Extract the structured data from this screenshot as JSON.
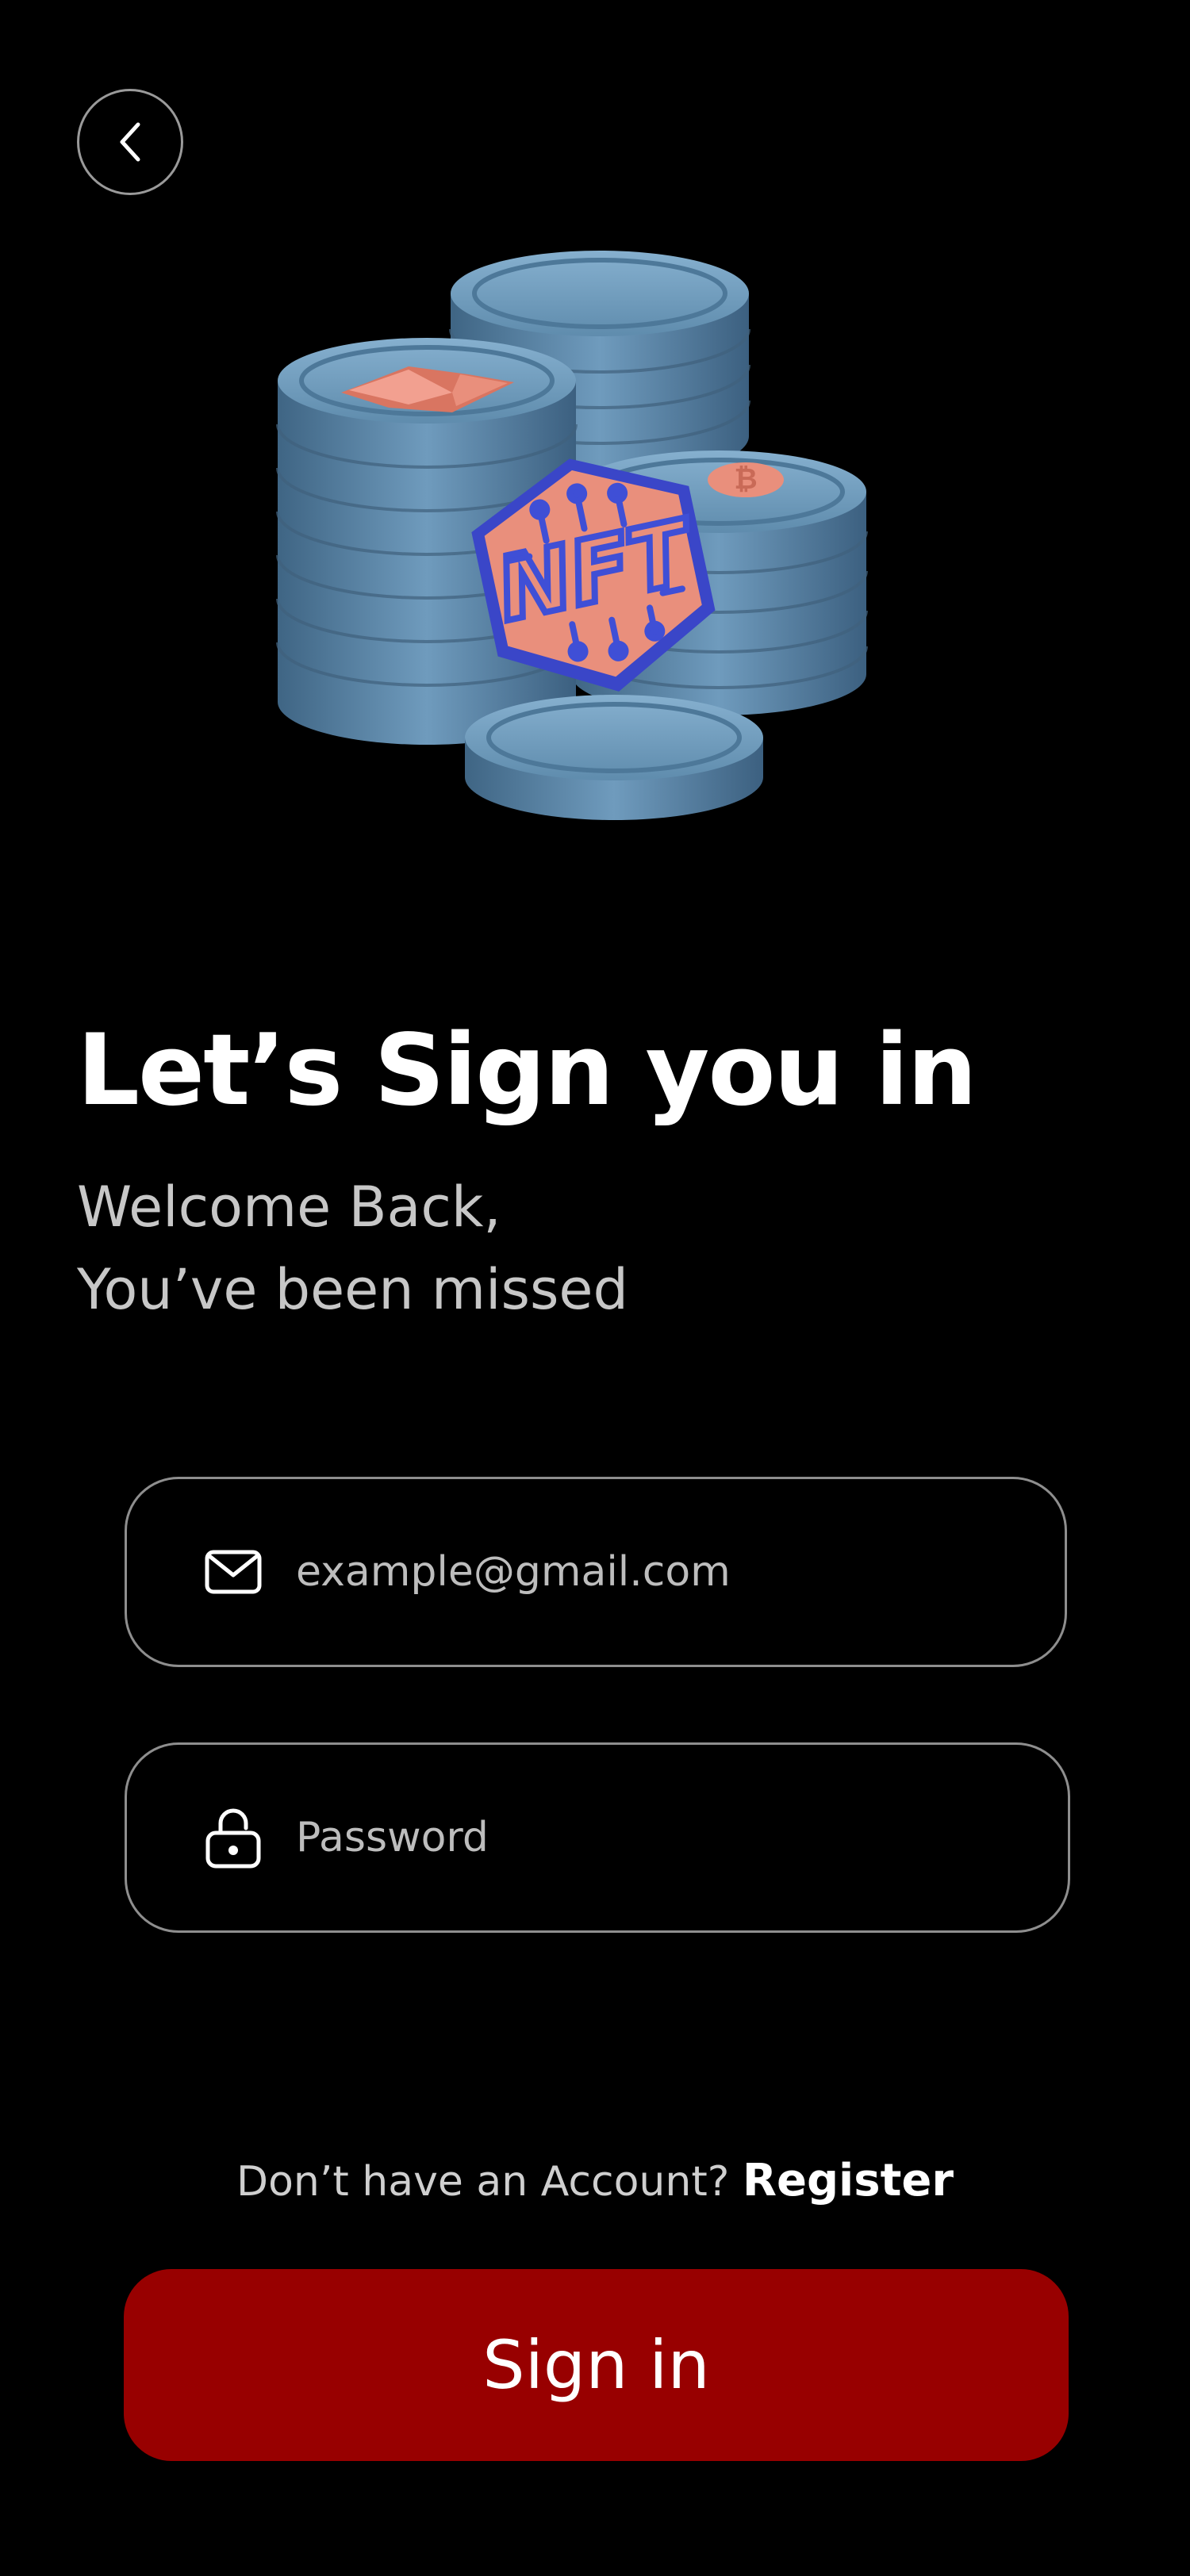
{
  "header": {
    "back_icon": "chevron-left-icon"
  },
  "hero": {
    "badge_text": "NFT"
  },
  "content": {
    "title": "Let’s Sign you in",
    "subtitle_line1": "Welcome Back,",
    "subtitle_line2": "You’ve been missed"
  },
  "form": {
    "email": {
      "icon": "mail-icon",
      "placeholder": "example@gmail.com",
      "value": ""
    },
    "password": {
      "icon": "lock-icon",
      "placeholder": "Password",
      "value": ""
    }
  },
  "register": {
    "prompt": "Don’t have an Account? ",
    "link_label": "Register"
  },
  "actions": {
    "signin_label": "Sign in"
  },
  "colors": {
    "background": "#000000",
    "primary_button": "#980000",
    "coin": "#5d8aa8",
    "badge": "#e98f7c",
    "badge_border": "#3f4fd6"
  }
}
